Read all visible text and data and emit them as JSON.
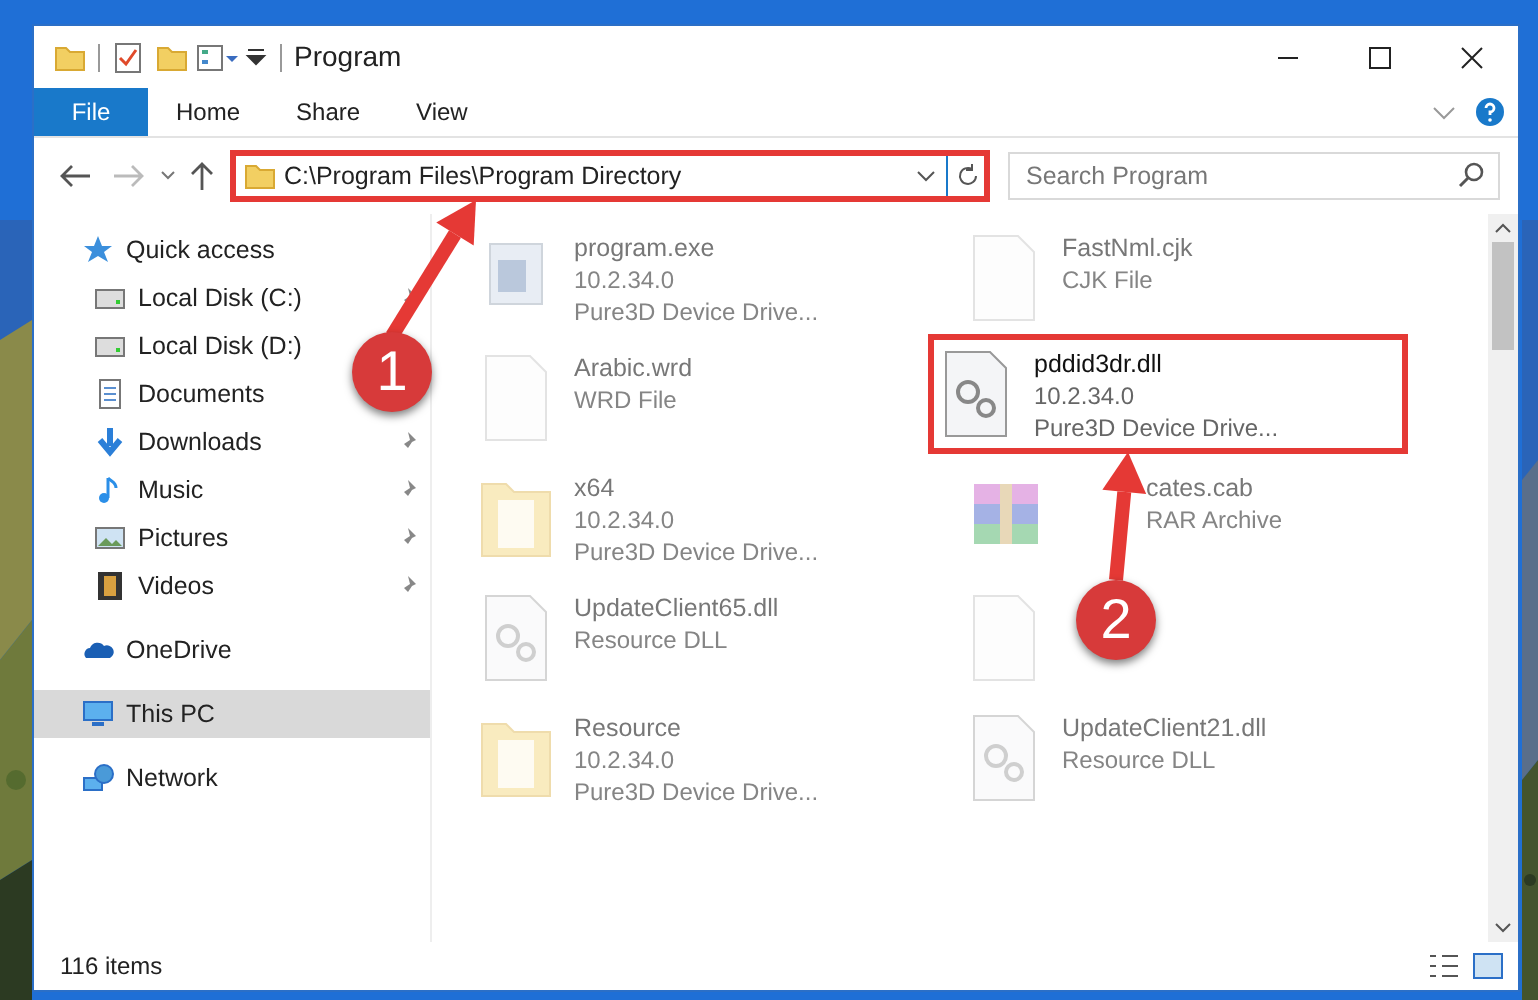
{
  "title_bar": {
    "title": "Program"
  },
  "ribbon_tabs": [
    {
      "label": "File",
      "kind": "file"
    },
    {
      "label": "Home",
      "kind": "tab"
    },
    {
      "label": "Share",
      "kind": "tab"
    },
    {
      "label": "View",
      "kind": "tab"
    }
  ],
  "address_bar": {
    "path": "C:\\Program Files\\Program Directory",
    "highlighted": true
  },
  "search": {
    "placeholder": "Search Program"
  },
  "sidebar": {
    "items": [
      {
        "label": "Quick access",
        "kind": "star",
        "selected": false,
        "children": [
          {
            "label": "Local Disk (C:)",
            "kind": "drive",
            "pinned": true,
            "selected": false
          },
          {
            "label": "Local Disk (D:)",
            "kind": "drive",
            "selected": false
          },
          {
            "label": "Documents",
            "kind": "doc",
            "selected": false
          },
          {
            "label": "Downloads",
            "kind": "download",
            "pinned": true,
            "selected": false
          },
          {
            "label": "Music",
            "kind": "music",
            "pinned": true,
            "selected": false
          },
          {
            "label": "Pictures",
            "kind": "pictures",
            "pinned": true,
            "selected": false
          },
          {
            "label": "Videos",
            "kind": "video",
            "pinned": true,
            "selected": false
          }
        ]
      },
      {
        "label": "OneDrive",
        "kind": "cloud",
        "selected": false
      },
      {
        "label": "This PC",
        "kind": "pc",
        "selected": true
      },
      {
        "label": "Network",
        "kind": "network",
        "selected": false
      }
    ]
  },
  "files": [
    {
      "name": "program.exe",
      "lines": [
        "10.2.34.0",
        "Pure3D Device Drive..."
      ],
      "kind": "exe",
      "highlighted": false
    },
    {
      "name": "FastNml.cjk",
      "lines": [
        "CJK File"
      ],
      "kind": "blank",
      "highlighted": false
    },
    {
      "name": "Arabic.wrd",
      "lines": [
        "WRD File"
      ],
      "kind": "blank",
      "highlighted": false
    },
    {
      "name": "pddid3dr.dll",
      "lines": [
        "10.2.34.0",
        "Pure3D Device Drive..."
      ],
      "kind": "dll",
      "highlighted": true
    },
    {
      "name": "x64",
      "lines": [
        "10.2.34.0",
        "Pure3D Device Drive..."
      ],
      "kind": "folder",
      "highlighted": false
    },
    {
      "name": "cates.cab",
      "lines": [
        "RAR Archive"
      ],
      "kind": "archive",
      "highlighted": false
    },
    {
      "name": "UpdateClient65.dll",
      "lines": [
        "Resource DLL"
      ],
      "kind": "dll",
      "highlighted": false
    },
    {
      "kind": "blank",
      "highlighted": false
    },
    {
      "name": "Resource",
      "lines": [
        "10.2.34.0",
        "Pure3D Device Drive..."
      ],
      "kind": "folder",
      "highlighted": false
    },
    {
      "name": "UpdateClient21.dll",
      "lines": [
        "Resource DLL"
      ],
      "kind": "dll",
      "highlighted": false
    }
  ],
  "status_bar": {
    "item_count": "116 items"
  },
  "annotations": [
    {
      "number": "1"
    },
    {
      "number": "2"
    }
  ]
}
